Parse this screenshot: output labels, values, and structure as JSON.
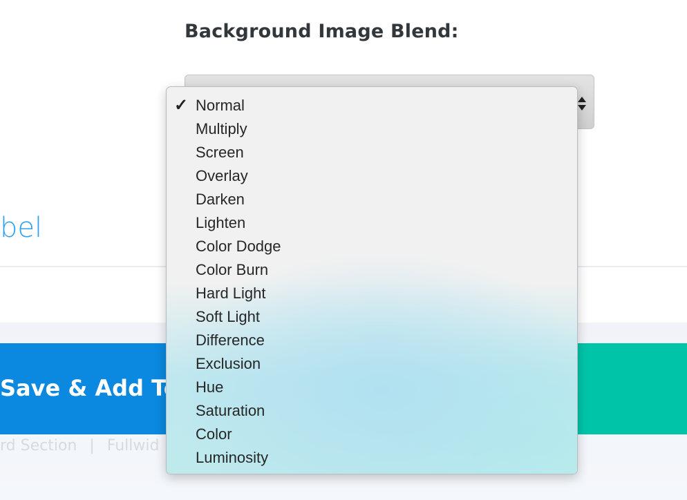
{
  "field": {
    "heading": "Background Image Blend:",
    "selected": "Normal"
  },
  "page": {
    "left_label": "bel",
    "primary_button_label": "Save & Add To",
    "footer_links": [
      "rd Section",
      "|",
      "Fullwid"
    ]
  },
  "dropdown": {
    "check_glyph": "✓",
    "options": [
      {
        "label": "Normal",
        "checked": true
      },
      {
        "label": "Multiply"
      },
      {
        "label": "Screen"
      },
      {
        "label": "Overlay"
      },
      {
        "label": "Darken"
      },
      {
        "label": "Lighten"
      },
      {
        "label": "Color Dodge"
      },
      {
        "label": "Color Burn"
      },
      {
        "label": "Hard Light"
      },
      {
        "label": "Soft Light"
      },
      {
        "label": "Difference"
      },
      {
        "label": "Exclusion"
      },
      {
        "label": "Hue"
      },
      {
        "label": "Saturation"
      },
      {
        "label": "Color"
      },
      {
        "label": "Luminosity"
      }
    ]
  },
  "icons": {
    "select": "updown-arrows-icon",
    "checkmark": "checkmark-icon"
  },
  "colors": {
    "link_blue": "#2ea3f2",
    "primary_button": "#0b88e0",
    "secondary_button": "#00c4a8",
    "heading": "#32373c"
  }
}
